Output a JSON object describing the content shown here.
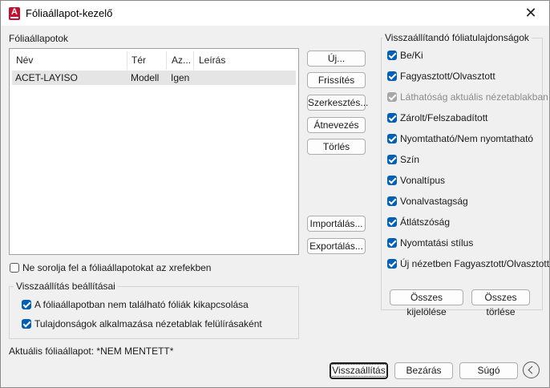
{
  "window": {
    "title": "Fóliaállapot-kezelő",
    "close_glyph": "✕",
    "app_icon_letter": "A"
  },
  "states_label": "Fóliaállapotok",
  "list": {
    "columns": [
      "Név",
      "Tér",
      "Az...",
      "Leírás"
    ],
    "rows": [
      {
        "name": "ACET-LAYISO",
        "space": "Modell",
        "same": "Igen",
        "desc": ""
      }
    ]
  },
  "buttons": {
    "new": "Új...",
    "update": "Frissítés",
    "edit": "Szerkesztés...",
    "rename": "Átnevezés",
    "delete": "Törlés",
    "import": "Importálás...",
    "export": "Exportálás...",
    "select_all": "Összes kijelölése",
    "clear_all": "Összes törlése",
    "restore": "Visszaállítás",
    "close": "Bezárás",
    "help": "Súgó"
  },
  "xref_option": {
    "label": "Ne sorolja fel a fóliaállapotokat az xrefekben",
    "checked": false
  },
  "restore_options": {
    "title": "Visszaállítás beállításai",
    "items": [
      {
        "label": "A fóliaállapotban nem található fóliák kikapcsolása",
        "checked": true
      },
      {
        "label": "Tulajdonságok alkalmazása nézetablak felülírásaként",
        "checked": true
      }
    ]
  },
  "properties": {
    "title": "Visszaállítandó fóliatulajdonságok",
    "items": [
      {
        "label": "Be/Ki",
        "checked": true,
        "enabled": true
      },
      {
        "label": "Fagyasztott/Olvasztott",
        "checked": true,
        "enabled": true
      },
      {
        "label": "Láthatóság aktuális nézetablakban",
        "checked": true,
        "enabled": false
      },
      {
        "label": "Zárolt/Felszabadított",
        "checked": true,
        "enabled": true
      },
      {
        "label": "Nyomtatható/Nem nyomtatható",
        "checked": true,
        "enabled": true
      },
      {
        "label": "Szín",
        "checked": true,
        "enabled": true
      },
      {
        "label": "Vonaltípus",
        "checked": true,
        "enabled": true
      },
      {
        "label": "Vonalvastagság",
        "checked": true,
        "enabled": true
      },
      {
        "label": "Átlátszóság",
        "checked": true,
        "enabled": true
      },
      {
        "label": "Nyomtatási stílus",
        "checked": true,
        "enabled": true
      },
      {
        "label": "Új nézetben Fagyasztott/Olvasztott",
        "checked": true,
        "enabled": true
      }
    ]
  },
  "current_state": {
    "label": "Aktuális fóliaállapot:",
    "value": "*NEM MENTETT*"
  },
  "icons": {
    "app": "autocad-a-icon",
    "close": "close-icon",
    "back": "chevron-left-circle-icon"
  },
  "colors": {
    "accent": "#005fb8",
    "app_icon": "#c8102e",
    "selected_row": "#e5e5e5"
  }
}
